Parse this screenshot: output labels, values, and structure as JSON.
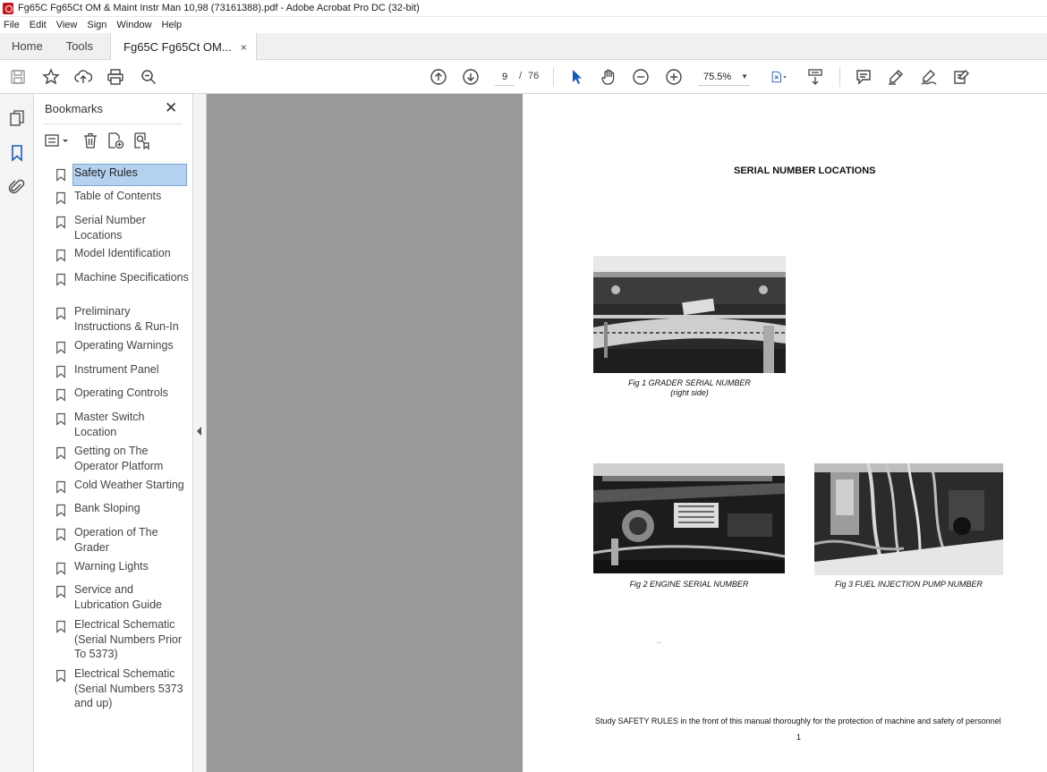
{
  "window": {
    "title": "Fg65C Fg65Ct OM & Maint Instr Man 10,98 (73161388).pdf - Adobe Acrobat Pro DC (32-bit)"
  },
  "menu": [
    "File",
    "Edit",
    "View",
    "Sign",
    "Window",
    "Help"
  ],
  "tabs": {
    "home": "Home",
    "tools": "Tools",
    "document": "Fg65C Fg65Ct OM...",
    "close": "×"
  },
  "toolbar": {
    "current_page": "9",
    "page_separator": "/",
    "total_pages": "76",
    "zoom": "75.5%",
    "icons": [
      "save-icon",
      "bookmark-star-icon",
      "upload-icon",
      "print-icon",
      "find-icon",
      "page-up-icon",
      "page-down-icon",
      "select-cursor-icon",
      "hand-icon",
      "zoom-out-icon",
      "zoom-in-icon",
      "page-display-icon",
      "scroll-mode-icon",
      "comment-icon",
      "highlight-icon",
      "sign-icon",
      "fill-sign-icon"
    ]
  },
  "rail": {
    "icons": [
      "page-thumbnails-icon",
      "bookmarks-icon",
      "attachments-icon"
    ]
  },
  "bookmarks_panel": {
    "title": "Bookmarks",
    "close": "✕",
    "items": [
      {
        "label": "Safety Rules",
        "selected": true
      },
      {
        "label": "Table of Contents"
      },
      {
        "label": "Serial Number Locations"
      },
      {
        "label": "Model Identification"
      },
      {
        "label": "Machine Specifications"
      },
      {
        "label": "Preliminary Instructions & Run-In"
      },
      {
        "label": "Operating Warnings"
      },
      {
        "label": "Instrument Panel"
      },
      {
        "label": "Operating Controls"
      },
      {
        "label": "Master Switch Location"
      },
      {
        "label": "Getting on The Operator Platform"
      },
      {
        "label": "Cold Weather Starting"
      },
      {
        "label": "Bank Sloping"
      },
      {
        "label": "Operation of The Grader"
      },
      {
        "label": "Warning Lights"
      },
      {
        "label": "Service and Lubrication Guide"
      },
      {
        "label": "Electrical Schematic (Serial Numbers Prior To 5373)"
      },
      {
        "label": "Electrical Schematic (Serial Numbers 5373 and up)"
      }
    ]
  },
  "document_page": {
    "heading": "SERIAL NUMBER LOCATIONS",
    "fig1_line1": "Fig 1 GRADER SERIAL NUMBER",
    "fig1_line2": "(right side)",
    "fig2": "Fig 2 ENGINE SERIAL NUMBER",
    "fig3": "Fig 3 FUEL INJECTION PUMP NUMBER",
    "speck": "..",
    "footer": "Study SAFETY RULES in the front of this manual thoroughly for the protection of machine and safety of personnel",
    "page_number": "1"
  }
}
